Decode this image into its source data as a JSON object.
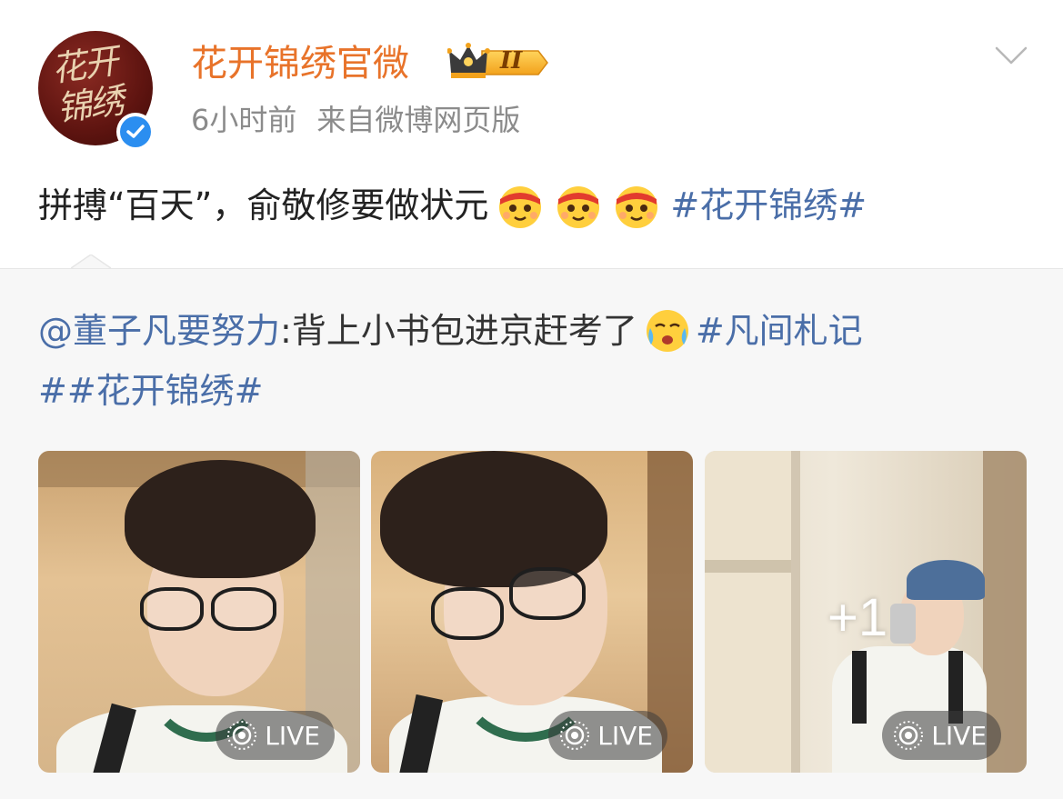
{
  "header": {
    "username": "花开锦绣官微",
    "avatar_text": "花开锦绣",
    "vip_level": "II",
    "time": "6小时前",
    "source": "来自微博网页版",
    "verified_color": "#2b8ef0",
    "username_color": "#e8732a"
  },
  "post": {
    "text": "拼搏“百天”，俞敬修要做状元",
    "emoji_count": 3,
    "hashtag": "#花开锦绣#"
  },
  "repost": {
    "mention": "@董子凡要努力",
    "separator": ":",
    "text": "背上小书包进京赶考了",
    "hashtag1": "#凡间札记",
    "line2": "##花开锦绣#"
  },
  "photos": [
    {
      "badge": "LIVE"
    },
    {
      "badge": "LIVE"
    },
    {
      "badge": "LIVE",
      "more": "+1"
    }
  ],
  "colors": {
    "link": "#4a6ea8",
    "text": "#222222",
    "meta": "#8b8b8b",
    "repost_bg": "#f7f7f7"
  }
}
